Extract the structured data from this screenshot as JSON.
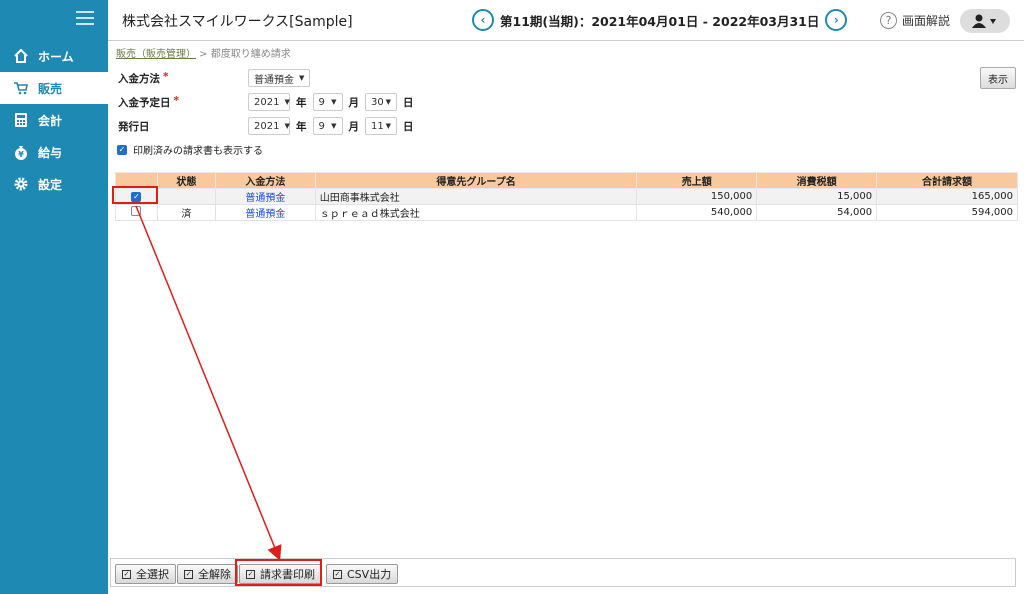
{
  "header": {
    "company": "株式会社スマイルワークス[Sample]",
    "period": "第11期(当期)：2021年04月01日 - 2022年03月31日",
    "help": "画面解説",
    "prev": "‹",
    "next": "›"
  },
  "sidebar": {
    "items": [
      {
        "label": "ホーム",
        "icon": "home-icon"
      },
      {
        "label": "販売",
        "icon": "cart-icon",
        "active": true
      },
      {
        "label": "会計",
        "icon": "calculator-icon"
      },
      {
        "label": "給与",
        "icon": "money-bag-icon"
      },
      {
        "label": "設定",
        "icon": "gear-icon"
      }
    ]
  },
  "breadcrumb": {
    "link": "販売（販売管理）",
    "sep": " > ",
    "current": "都度取り纏め請求"
  },
  "form": {
    "payment_method_label": "入金方法",
    "payment_method_value": "普通預金",
    "due_date_label": "入金予定日",
    "due_year": "2021",
    "due_month": "9",
    "due_day": "30",
    "issue_date_label": "発行日",
    "issue_year": "2021",
    "issue_month": "9",
    "issue_day": "11",
    "year_unit": "年",
    "month_unit": "月",
    "day_unit": "日",
    "required_mark": "*",
    "show_printed_label": "印刷済みの請求書も表示する",
    "show_button": "表示"
  },
  "table": {
    "headers": [
      "",
      "状態",
      "入金方法",
      "得意先グループ名",
      "売上額",
      "消費税額",
      "合計請求額"
    ],
    "rows": [
      {
        "checked": true,
        "status": "",
        "method": "普通預金",
        "customer": "山田商事株式会社",
        "sales": "150,000",
        "tax": "15,000",
        "total": "165,000"
      },
      {
        "checked": false,
        "status": "済",
        "method": "普通預金",
        "customer": "ｓｐｒｅａｄ株式会社",
        "sales": "540,000",
        "tax": "54,000",
        "total": "594,000"
      }
    ]
  },
  "bottom": {
    "select_all": "全選択",
    "deselect_all": "全解除",
    "print_invoice": "請求書印刷",
    "csv_output": "CSV出力"
  },
  "colors": {
    "sidebar": "#1e8ab3",
    "table_header": "#f7c99c",
    "highlight": "#e21b1b",
    "link": "#1a4ec9"
  }
}
